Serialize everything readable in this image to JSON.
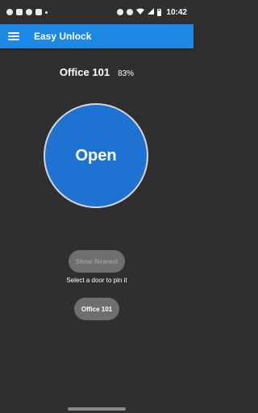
{
  "status_bar": {
    "time": "10:42",
    "left_icons": [
      "location-icon",
      "youtube-icon",
      "settings-icon",
      "photos-icon",
      "dot-icon"
    ],
    "right_icons": [
      "alarm-icon",
      "do-not-disturb-icon",
      "wifi-icon",
      "signal-icon",
      "battery-icon"
    ]
  },
  "app_bar": {
    "title": "Easy Unlock",
    "menu_icon": "hamburger-menu-icon"
  },
  "door": {
    "name": "Office 101",
    "battery": "83%"
  },
  "main": {
    "open_label": "Open",
    "show_nearest_label": "Show Nearest",
    "hint": "Select a door to pin it",
    "door_chip_label": "Office 101"
  },
  "colors": {
    "app_bar": "#1e88e5",
    "open_button": "#1e73d2",
    "background": "#2f2f2f",
    "chip": "#6f6f6f"
  }
}
